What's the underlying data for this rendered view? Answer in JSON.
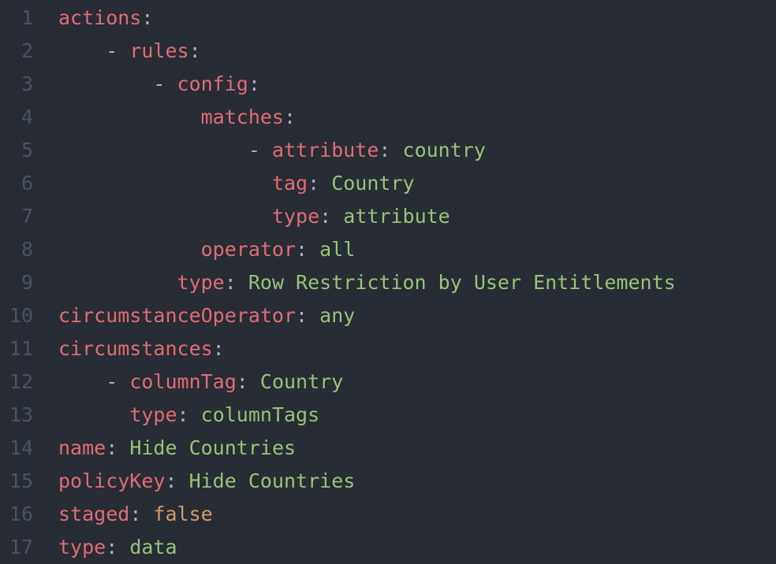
{
  "lineNumbers": [
    "1",
    "2",
    "3",
    "4",
    "5",
    "6",
    "7",
    "8",
    "9",
    "10",
    "11",
    "12",
    "13",
    "14",
    "15",
    "16",
    "17"
  ],
  "lines": [
    [
      [
        "key",
        "actions"
      ],
      [
        "punct",
        ":"
      ]
    ],
    [
      [
        "dash",
        "    - "
      ],
      [
        "key",
        "rules"
      ],
      [
        "punct",
        ":"
      ]
    ],
    [
      [
        "dash",
        "        - "
      ],
      [
        "key",
        "config"
      ],
      [
        "punct",
        ":"
      ]
    ],
    [
      [
        "indent",
        "            "
      ],
      [
        "key",
        "matches"
      ],
      [
        "punct",
        ":"
      ]
    ],
    [
      [
        "dash",
        "                - "
      ],
      [
        "key",
        "attribute"
      ],
      [
        "punct",
        ": "
      ],
      [
        "str",
        "country"
      ]
    ],
    [
      [
        "indent",
        "                  "
      ],
      [
        "key",
        "tag"
      ],
      [
        "punct",
        ": "
      ],
      [
        "str",
        "Country"
      ]
    ],
    [
      [
        "indent",
        "                  "
      ],
      [
        "key",
        "type"
      ],
      [
        "punct",
        ": "
      ],
      [
        "str",
        "attribute"
      ]
    ],
    [
      [
        "indent",
        "            "
      ],
      [
        "key",
        "operator"
      ],
      [
        "punct",
        ": "
      ],
      [
        "str",
        "all"
      ]
    ],
    [
      [
        "indent",
        "          "
      ],
      [
        "key",
        "type"
      ],
      [
        "punct",
        ": "
      ],
      [
        "str",
        "Row Restriction by User Entitlements"
      ]
    ],
    [
      [
        "key",
        "circumstanceOperator"
      ],
      [
        "punct",
        ": "
      ],
      [
        "str",
        "any"
      ]
    ],
    [
      [
        "key",
        "circumstances"
      ],
      [
        "punct",
        ":"
      ]
    ],
    [
      [
        "dash",
        "    - "
      ],
      [
        "key",
        "columnTag"
      ],
      [
        "punct",
        ": "
      ],
      [
        "str",
        "Country"
      ]
    ],
    [
      [
        "indent",
        "      "
      ],
      [
        "key",
        "type"
      ],
      [
        "punct",
        ": "
      ],
      [
        "str",
        "columnTags"
      ]
    ],
    [
      [
        "key",
        "name"
      ],
      [
        "punct",
        ": "
      ],
      [
        "str",
        "Hide Countries"
      ]
    ],
    [
      [
        "key",
        "policyKey"
      ],
      [
        "punct",
        ": "
      ],
      [
        "str",
        "Hide Countries"
      ]
    ],
    [
      [
        "key",
        "staged"
      ],
      [
        "punct",
        ": "
      ],
      [
        "bool",
        "false"
      ]
    ],
    [
      [
        "key",
        "type"
      ],
      [
        "punct",
        ": "
      ],
      [
        "str",
        "data"
      ]
    ]
  ],
  "yaml_data": {
    "actions": [
      {
        "rules": [
          {
            "config": {
              "matches": [
                {
                  "attribute": "country",
                  "tag": "Country",
                  "type": "attribute"
                }
              ],
              "operator": "all"
            },
            "type": "Row Restriction by User Entitlements"
          }
        ]
      }
    ],
    "circumstanceOperator": "any",
    "circumstances": [
      {
        "columnTag": "Country",
        "type": "columnTags"
      }
    ],
    "name": "Hide Countries",
    "policyKey": "Hide Countries",
    "staged": false,
    "type": "data"
  }
}
